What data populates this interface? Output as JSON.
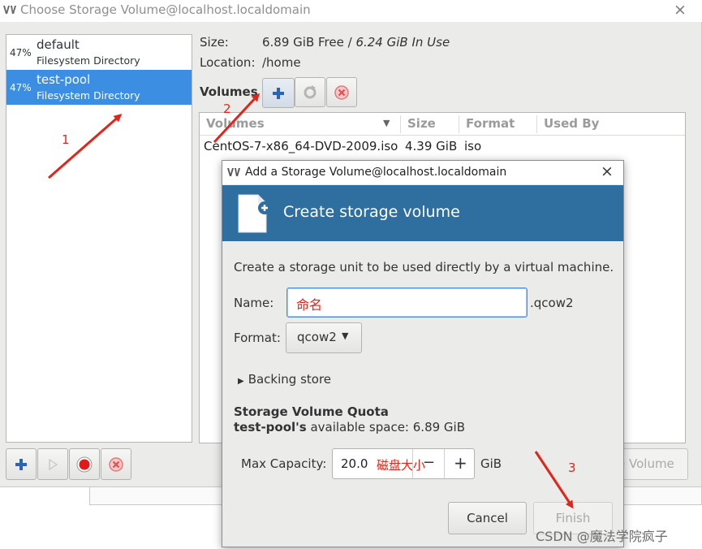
{
  "main_window": {
    "title": "Choose Storage Volume@localhost.localdomain",
    "close_icon": "×",
    "pools": [
      {
        "percent": "47%",
        "name": "default",
        "type": "Filesystem Directory"
      },
      {
        "percent": "47%",
        "name": "test-pool",
        "type": "Filesystem Directory",
        "selected": true
      }
    ],
    "size_label": "Size:",
    "size_free": "6.89 GiB Free",
    "size_sep": " / ",
    "size_in_use": "6.24 GiB In Use",
    "location_label": "Location:",
    "location_value": "/home",
    "volumes_label": "Volumes",
    "table": {
      "headers": [
        "Volumes",
        "Size",
        "Format",
        "Used By"
      ],
      "rows": [
        {
          "name": "CentOS-7-x86_64-DVD-2009.iso",
          "size": "4.39 GiB",
          "format": "iso",
          "used_by": ""
        }
      ]
    },
    "choose_volume_button": "e Volume"
  },
  "dialog": {
    "title": "Add a Storage Volume@localhost.localdomain",
    "close_icon": "×",
    "header_title": "Create storage volume",
    "description": "Create a storage unit to be used directly by a virtual machine.",
    "name_label": "Name:",
    "name_value": "命名",
    "name_suffix": ".qcow2",
    "format_label": "Format:",
    "format_value": "qcow2",
    "backing_store": "Backing store",
    "quota_title": "Storage Volume Quota",
    "quota_pool": "test-pool's",
    "quota_text": " available space: 6.89 GiB",
    "capacity_label": "Max Capacity:",
    "capacity_value": "20.0",
    "capacity_minus": "−",
    "capacity_plus": "+",
    "capacity_unit": "GiB",
    "cancel_button": "Cancel",
    "finish_button": "Finish"
  },
  "annotations": {
    "step1": "1",
    "step2": "2",
    "step3": "3",
    "capacity_note": "磁盘大小"
  },
  "watermark": "CSDN @魔法学院疯子",
  "colors": {
    "selection": "#3c8ee2",
    "banner": "#2f6f9f",
    "annotation": "#e0261a",
    "input_focus": "#4a90d9"
  }
}
